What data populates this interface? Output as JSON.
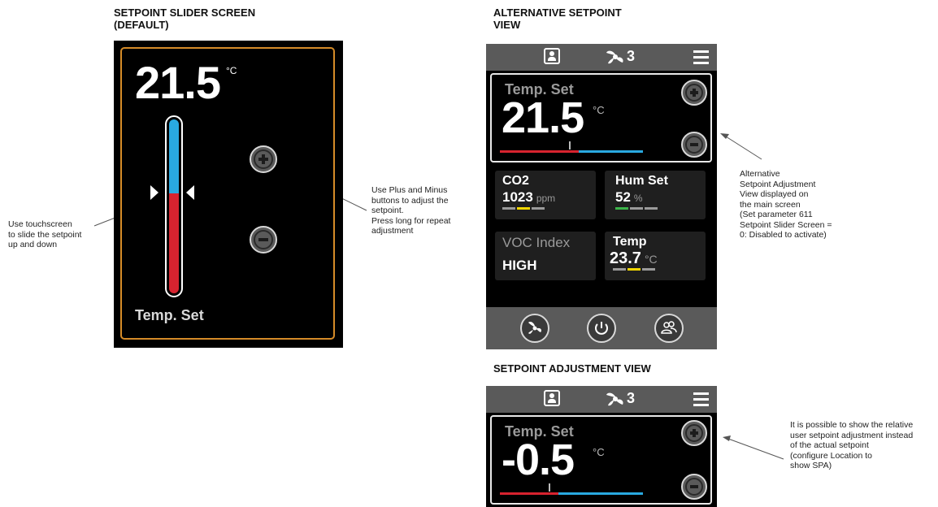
{
  "headings": {
    "slider_screen": "SETPOINT SLIDER SCREEN\n(DEFAULT)",
    "alternative": "ALTERNATIVE SETPOINT\nVIEW",
    "adjustment": "SETPOINT ADJUSTMENT VIEW"
  },
  "notes": {
    "touchscreen": "Use touchscreen\nto slide the setpoint\nup and down",
    "plus_minus": "Use Plus and Minus\nbuttons to adjust the\nsetpoint.\nPress long for repeat\nadjustment",
    "alternative": "Alternative\nSetpoint Adjustment\nView displayed on\nthe main screen\n(Set parameter 611\nSetpoint Slider Screen =\n0: Disabled to activate)",
    "relative": "It is possible to show the relative\nuser setpoint adjustment instead\nof the actual setpoint\n(configure Location to\nshow SPA)"
  },
  "slider_screen": {
    "value": "21.5",
    "unit": "°C",
    "label": "Temp. Set",
    "slider_fraction": 0.43,
    "colors": {
      "frame": "#d58b28",
      "upper": "#29a9e0",
      "lower": "#d7232f"
    },
    "icons": [
      "plus-icon",
      "minus-icon",
      "arrow-right-icon",
      "arrow-left-icon"
    ]
  },
  "alternative_view": {
    "topbar": {
      "fan_level": "3",
      "icons": [
        "person-icon",
        "fan-icon",
        "menu-icon"
      ]
    },
    "setpoint": {
      "title": "Temp. Set",
      "value": "21.5",
      "unit": "°C",
      "bar_fraction": 0.55
    },
    "tiles": [
      {
        "label": "CO2",
        "value": "1023",
        "unit": "ppm",
        "indicators": [
          "#9a9a9a",
          "#f2d600",
          "#9a9a9a"
        ]
      },
      {
        "label": "Hum Set",
        "value": "52",
        "unit": "%",
        "indicators": [
          "#3cb44a",
          "#9a9a9a",
          "#9a9a9a"
        ]
      },
      {
        "label": "VOC Index",
        "value": "HIGH",
        "unit": ""
      },
      {
        "label": "Temp",
        "value": "23.7",
        "unit": "°C",
        "indicators": [
          "#9a9a9a",
          "#f2d600",
          "#9a9a9a"
        ]
      }
    ],
    "bottombar": {
      "icons": [
        "fan-mode-icon",
        "power-icon",
        "occupancy-icon"
      ]
    }
  },
  "adjustment_view": {
    "topbar": {
      "fan_level": "3"
    },
    "setpoint": {
      "title": "Temp. Set",
      "value": "-0.5",
      "unit": "°C",
      "bar_fraction": 0.41
    }
  }
}
